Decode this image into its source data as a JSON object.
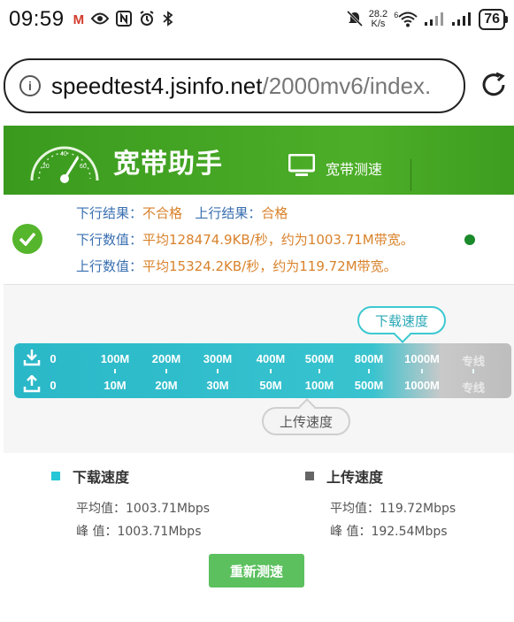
{
  "status_bar": {
    "time": "09:59",
    "net_speed_value": "28.2",
    "net_speed_unit": "K/s",
    "wifi_label": "6",
    "battery": "76"
  },
  "browser": {
    "url_domain": "speedtest4.jsinfo.net",
    "url_path": "/2000mv6/index."
  },
  "header": {
    "title": "宽带助手",
    "tab_label": "宽带测速"
  },
  "results": {
    "line1_label_a": "下行结果：",
    "line1_value_a": "不合格",
    "line1_label_b": "上行结果：",
    "line1_value_b": "合格",
    "line2_label": "下行数值：",
    "line2_value": "平均128474.9KB/秒，约为1003.71M带宽。",
    "line3_label": "上行数值：",
    "line3_value": "平均15324.2KB/秒，约为119.72M带宽。"
  },
  "scale": {
    "download_bubble": "下载速度",
    "upload_bubble": "上传速度",
    "download_ticks": [
      "0",
      "100M",
      "200M",
      "300M",
      "400M",
      "500M",
      "800M",
      "1000M",
      "专线"
    ],
    "upload_ticks": [
      "0",
      "10M",
      "20M",
      "30M",
      "50M",
      "100M",
      "500M",
      "1000M",
      "专线"
    ]
  },
  "stats": {
    "download": {
      "title": "下载速度",
      "avg": "平均值：1003.71Mbps",
      "peak": "峰 值：1003.71Mbps",
      "color": "#25c6d6"
    },
    "upload": {
      "title": "上传速度",
      "avg": "平均值：119.72Mbps",
      "peak": "峰 值：192.54Mbps",
      "color": "#666666"
    },
    "retest_label": "重新测速"
  },
  "colors": {
    "header_green": "#4cae28",
    "label_blue": "#3a6fb0",
    "value_orange": "#d9822b",
    "scale_teal": "#38c3cf",
    "button_green": "#5cc05e"
  }
}
